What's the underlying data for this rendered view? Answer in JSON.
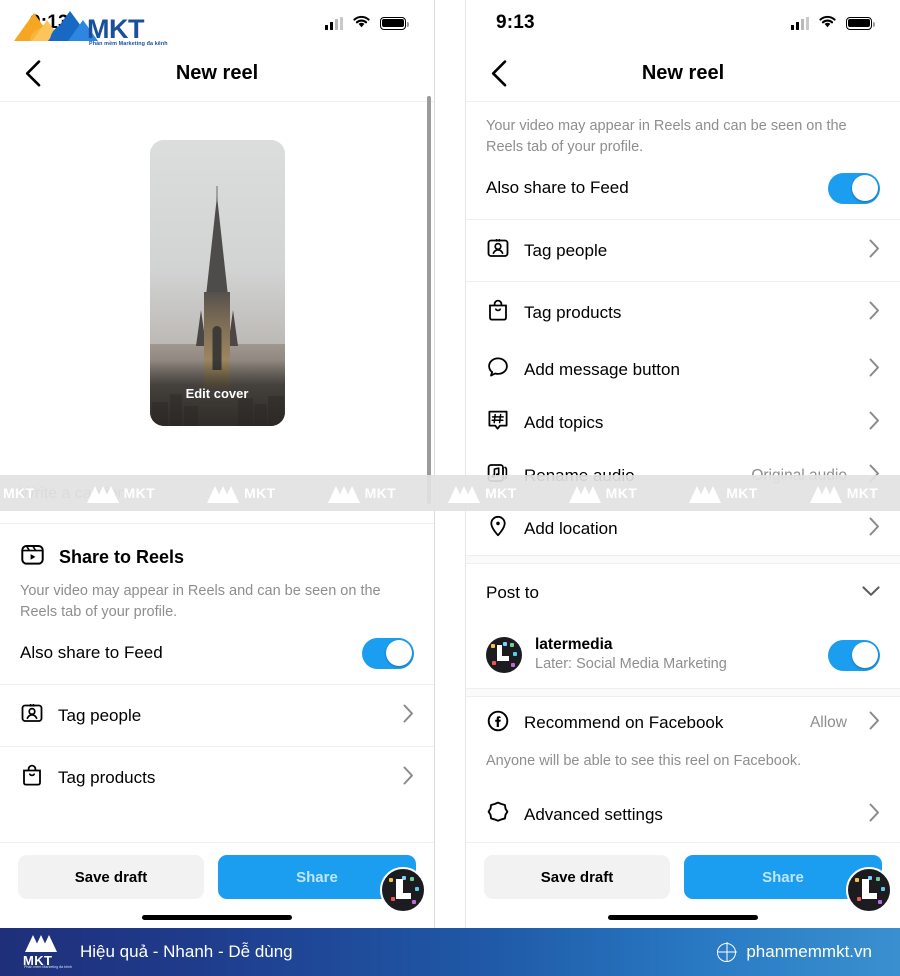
{
  "brand": {
    "name": "MKT",
    "tagline": "Phần mềm Marketing đa kênh",
    "slogan": "Hiệu quả - Nhanh - Dễ dùng",
    "website": "phanmemmkt.vn",
    "watermark_text": "MKT",
    "globe_icon": "globe-icon",
    "bar_gradient_start": "#1f2f7a",
    "bar_gradient_end": "#3a90cf"
  },
  "colors": {
    "accent_blue": "#1b9df0",
    "share_button_text": "#bfe6ff",
    "muted_text": "#8e8e8e",
    "divider": "#efefef"
  },
  "left_panel": {
    "status": {
      "time": "9:13",
      "signal_icon": "signal-icon",
      "wifi_icon": "wifi-icon",
      "battery_icon": "battery-icon"
    },
    "nav": {
      "back_icon": "chevron-left-icon",
      "title": "New reel"
    },
    "video": {
      "edit_cover_label": "Edit cover"
    },
    "caption": {
      "placeholder": "Write a caption...",
      "value": ""
    },
    "share_section": {
      "icon": "reels-icon",
      "title": "Share to Reels",
      "description": "Your video may appear in Reels and can be seen on the Reels tab of your profile.",
      "toggle_label": "Also share to Feed",
      "toggle_on": true
    },
    "rows": [
      {
        "icon": "tag-people-icon",
        "label": "Tag people",
        "value": "",
        "chevron": "chevron-right-icon"
      },
      {
        "icon": "tag-products-icon",
        "label": "Tag products",
        "value": "",
        "chevron": "chevron-right-icon"
      }
    ],
    "actions": {
      "save_draft_label": "Save draft",
      "share_label": "Share",
      "avatar": "later-avatar-icon"
    }
  },
  "right_panel": {
    "status": {
      "time": "9:13",
      "signal_icon": "signal-icon",
      "wifi_icon": "wifi-icon",
      "battery_icon": "battery-icon"
    },
    "nav": {
      "back_icon": "chevron-left-icon",
      "title": "New reel"
    },
    "share_section": {
      "description": "Your video may appear in Reels and can be seen on the Reels tab of your profile.",
      "toggle_label": "Also share to Feed",
      "toggle_on": true
    },
    "rows": [
      {
        "icon": "tag-people-icon",
        "label": "Tag people",
        "value": "",
        "chevron": "chevron-right-icon"
      },
      {
        "icon": "tag-products-icon",
        "label": "Tag products",
        "value": "",
        "chevron": "chevron-right-icon"
      },
      {
        "icon": "message-bubble-icon",
        "label": "Add message button",
        "value": "",
        "chevron": "chevron-right-icon"
      },
      {
        "icon": "hashtag-icon",
        "label": "Add topics",
        "value": "",
        "chevron": "chevron-right-icon"
      },
      {
        "icon": "music-note-icon",
        "label": "Rename audio",
        "value": "Original audio",
        "chevron": "chevron-right-icon"
      },
      {
        "icon": "location-pin-icon",
        "label": "Add location",
        "value": "",
        "chevron": "chevron-right-icon"
      }
    ],
    "post_to": {
      "title": "Post to",
      "collapse_icon": "chevron-down-icon",
      "account": {
        "avatar": "later-avatar-icon",
        "name": "latermedia",
        "subtitle": "Later: Social Media Marketing",
        "toggle_on": true
      }
    },
    "facebook": {
      "icon": "facebook-icon",
      "label": "Recommend on Facebook",
      "value": "Allow",
      "chevron": "chevron-right-icon",
      "description": "Anyone will be able to see this reel on Facebook."
    },
    "advanced": {
      "icon": "advanced-settings-icon",
      "label": "Advanced settings",
      "chevron": "chevron-right-icon"
    },
    "actions": {
      "save_draft_label": "Save draft",
      "share_label": "Share",
      "avatar": "later-avatar-icon"
    }
  }
}
